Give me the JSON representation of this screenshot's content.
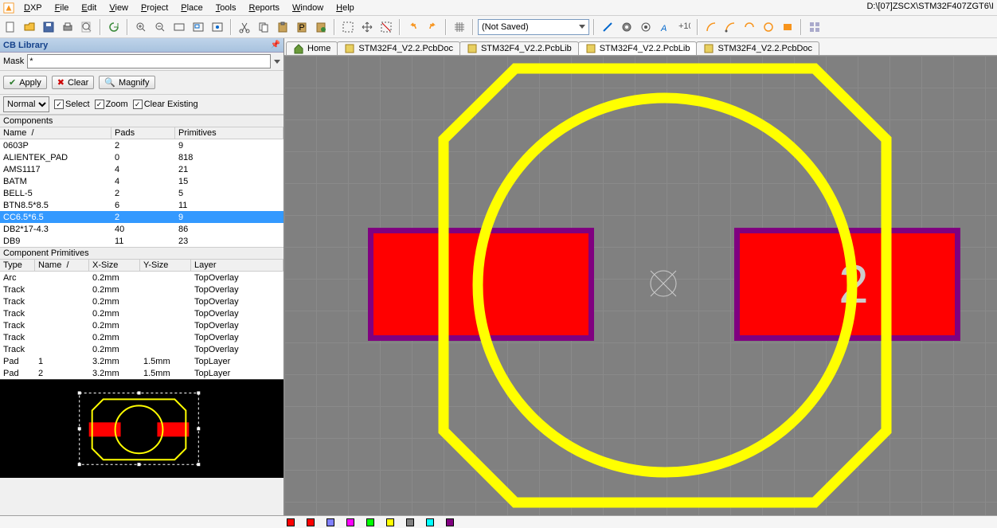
{
  "title_path": "D:\\[07]ZSCX\\STM32F407ZGT6\\I",
  "menu": {
    "items": [
      "DXP",
      "File",
      "Edit",
      "View",
      "Project",
      "Place",
      "Tools",
      "Reports",
      "Window",
      "Help"
    ]
  },
  "combo_status": "(Not Saved)",
  "panel": {
    "title": "CB Library",
    "mask_label": "Mask",
    "mask_value": "*",
    "btn_apply": "Apply",
    "btn_clear": "Clear",
    "btn_magnify": "Magnify",
    "mode": "Normal",
    "chk_select": "Select",
    "chk_zoom": "Zoom",
    "chk_clear": "Clear Existing",
    "components_title": "Components",
    "comp_head": [
      "Name",
      "Pads",
      "Primitives"
    ],
    "components": [
      {
        "name": "0603P",
        "pads": "2",
        "prims": "9"
      },
      {
        "name": "ALIENTEK_PAD",
        "pads": "0",
        "prims": "818"
      },
      {
        "name": "AMS1117",
        "pads": "4",
        "prims": "21"
      },
      {
        "name": "BATM",
        "pads": "4",
        "prims": "15"
      },
      {
        "name": "BELL-5",
        "pads": "2",
        "prims": "5"
      },
      {
        "name": "BTN8.5*8.5",
        "pads": "6",
        "prims": "11"
      },
      {
        "name": "CC6.5*6.5",
        "pads": "2",
        "prims": "9",
        "sel": true
      },
      {
        "name": "DB2*17-4.3",
        "pads": "40",
        "prims": "86"
      },
      {
        "name": "DB9",
        "pads": "11",
        "prims": "23"
      }
    ],
    "prim_title": "Component Primitives",
    "prim_head": [
      "Type",
      "Name",
      "X-Size",
      "Y-Size",
      "Layer"
    ],
    "prims": [
      {
        "t": "Arc",
        "n": "",
        "x": "0.2mm",
        "y": "",
        "l": "TopOverlay"
      },
      {
        "t": "Track",
        "n": "",
        "x": "0.2mm",
        "y": "",
        "l": "TopOverlay"
      },
      {
        "t": "Track",
        "n": "",
        "x": "0.2mm",
        "y": "",
        "l": "TopOverlay"
      },
      {
        "t": "Track",
        "n": "",
        "x": "0.2mm",
        "y": "",
        "l": "TopOverlay"
      },
      {
        "t": "Track",
        "n": "",
        "x": "0.2mm",
        "y": "",
        "l": "TopOverlay"
      },
      {
        "t": "Track",
        "n": "",
        "x": "0.2mm",
        "y": "",
        "l": "TopOverlay"
      },
      {
        "t": "Track",
        "n": "",
        "x": "0.2mm",
        "y": "",
        "l": "TopOverlay"
      },
      {
        "t": "Pad",
        "n": "1",
        "x": "3.2mm",
        "y": "1.5mm",
        "l": "TopLayer"
      },
      {
        "t": "Pad",
        "n": "2",
        "x": "3.2mm",
        "y": "1.5mm",
        "l": "TopLayer"
      }
    ]
  },
  "tabs": [
    {
      "label": "Home",
      "home": true
    },
    {
      "label": "STM32F4_V2.2.PcbDoc"
    },
    {
      "label": "STM32F4_V2.2.PcbLib"
    },
    {
      "label": "STM32F4_V2.2.PcbLib",
      "active": true
    },
    {
      "label": "STM32F4_V2.2.PcbDoc"
    }
  ],
  "pad2_label": "2",
  "layers": [
    {
      "c": "#ff0000",
      "t": ""
    },
    {
      "c": "#ff0000",
      "t": ""
    },
    {
      "c": "#8080ff",
      "t": ""
    },
    {
      "c": "#ff00ff",
      "t": ""
    },
    {
      "c": "#00ff00",
      "t": ""
    },
    {
      "c": "#ffff00",
      "t": ""
    },
    {
      "c": "#808080",
      "t": ""
    },
    {
      "c": "#00ffff",
      "t": ""
    },
    {
      "c": "#800080",
      "t": ""
    }
  ]
}
